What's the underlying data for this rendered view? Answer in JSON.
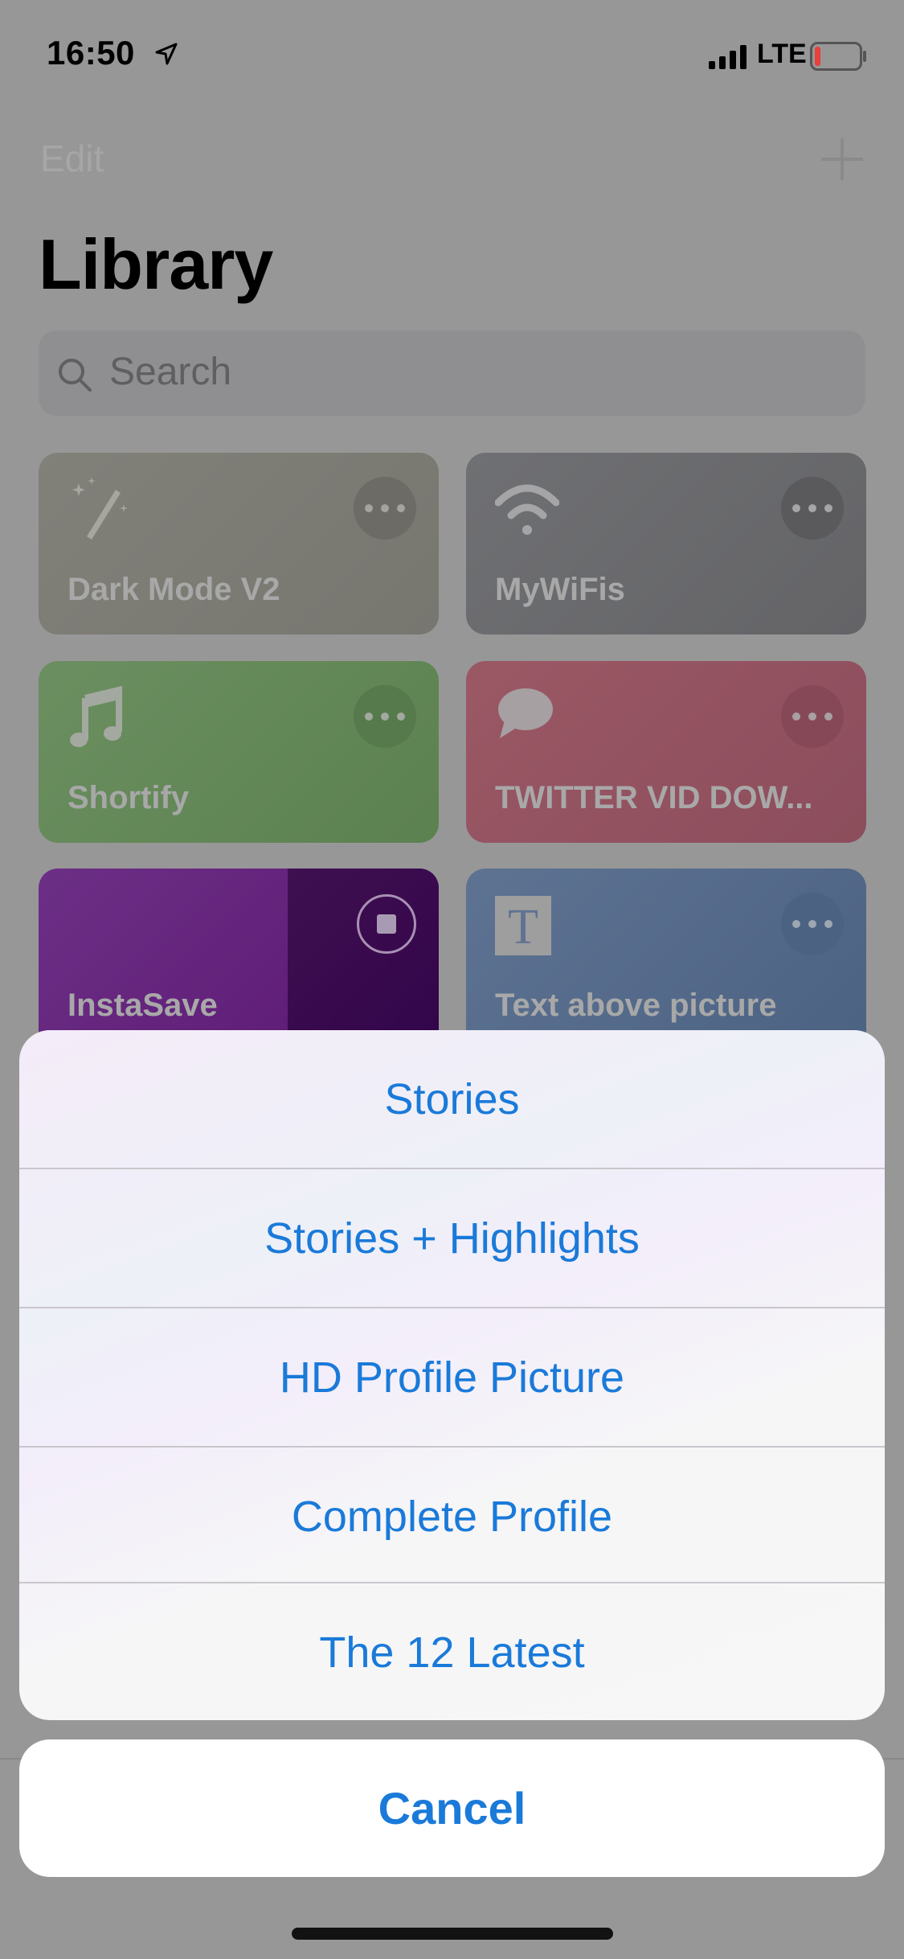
{
  "status_bar": {
    "time": "16:50",
    "location_icon": "location-arrow-icon",
    "signal_icon": "cellular-signal-icon",
    "network": "LTE",
    "battery_icon": "battery-low-icon",
    "battery_color": "#e8403a"
  },
  "nav": {
    "edit_label": "Edit",
    "add_icon": "plus-icon"
  },
  "page": {
    "title": "Library"
  },
  "search": {
    "placeholder": "Search",
    "icon": "magnifier-icon"
  },
  "shortcuts": [
    {
      "name": "Dark Mode V2",
      "icon": "magic-wand-icon",
      "color": "#7d7c76",
      "action_icon": "more-icon"
    },
    {
      "name": "MyWiFis",
      "icon": "wifi-icon",
      "color": "#6a6b6e",
      "action_icon": "more-icon"
    },
    {
      "name": "Shortify",
      "icon": "music-note-icon",
      "color": "#628857",
      "action_icon": "more-icon"
    },
    {
      "name": "TWITTER VID DOW...",
      "icon": "speech-bubble-icon",
      "color": "#935260",
      "action_icon": "more-icon"
    },
    {
      "name": "InstaSave",
      "icon": "none",
      "color": "#62207a",
      "action_icon": "stop-icon",
      "state": "running"
    },
    {
      "name": "Text above picture",
      "icon": "text-t-icon",
      "icon_letter": "T",
      "color": "#566b8b",
      "action_icon": "more-icon"
    }
  ],
  "action_sheet": {
    "accent_color": "#1a7ad9",
    "options": [
      {
        "label": "Stories"
      },
      {
        "label": "Stories + Highlights"
      },
      {
        "label": "HD Profile Picture"
      },
      {
        "label": "Complete Profile"
      },
      {
        "label": "The 12 Latest"
      }
    ],
    "cancel_label": "Cancel"
  }
}
